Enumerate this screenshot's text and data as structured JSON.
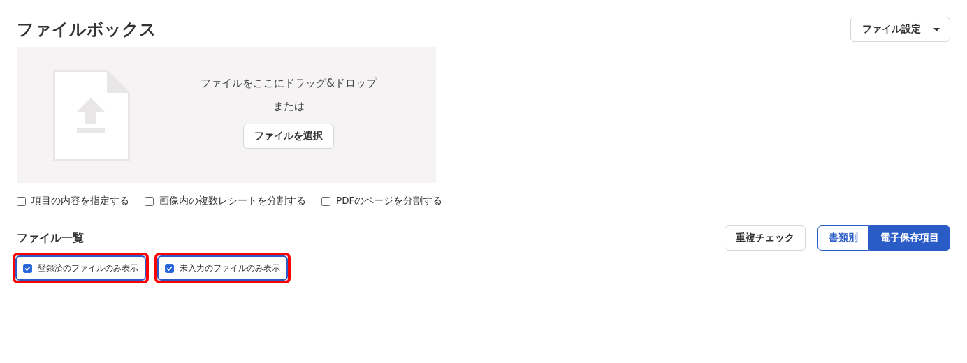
{
  "title": "ファイルボックス",
  "settings_button": {
    "label": "ファイル設定"
  },
  "dropzone": {
    "instruction": "ファイルをここにドラッグ&ドロップ",
    "or": "または",
    "button": "ファイルを選択"
  },
  "options": [
    {
      "label": "項目の内容を指定する",
      "checked": false
    },
    {
      "label": "画像内の複数レシートを分割する",
      "checked": false
    },
    {
      "label": "PDFのページを分割する",
      "checked": false
    }
  ],
  "file_list": {
    "heading": "ファイル一覧",
    "duplicate_button": "重複チェック",
    "view_tabs": [
      {
        "label": "書類別",
        "selected": false
      },
      {
        "label": "電子保存項目",
        "selected": true
      }
    ],
    "filters": [
      {
        "label": "登録済のファイルのみ表示",
        "checked": true,
        "highlighted": true
      },
      {
        "label": "未入力のファイルのみ表示",
        "checked": true,
        "highlighted": true
      }
    ]
  }
}
